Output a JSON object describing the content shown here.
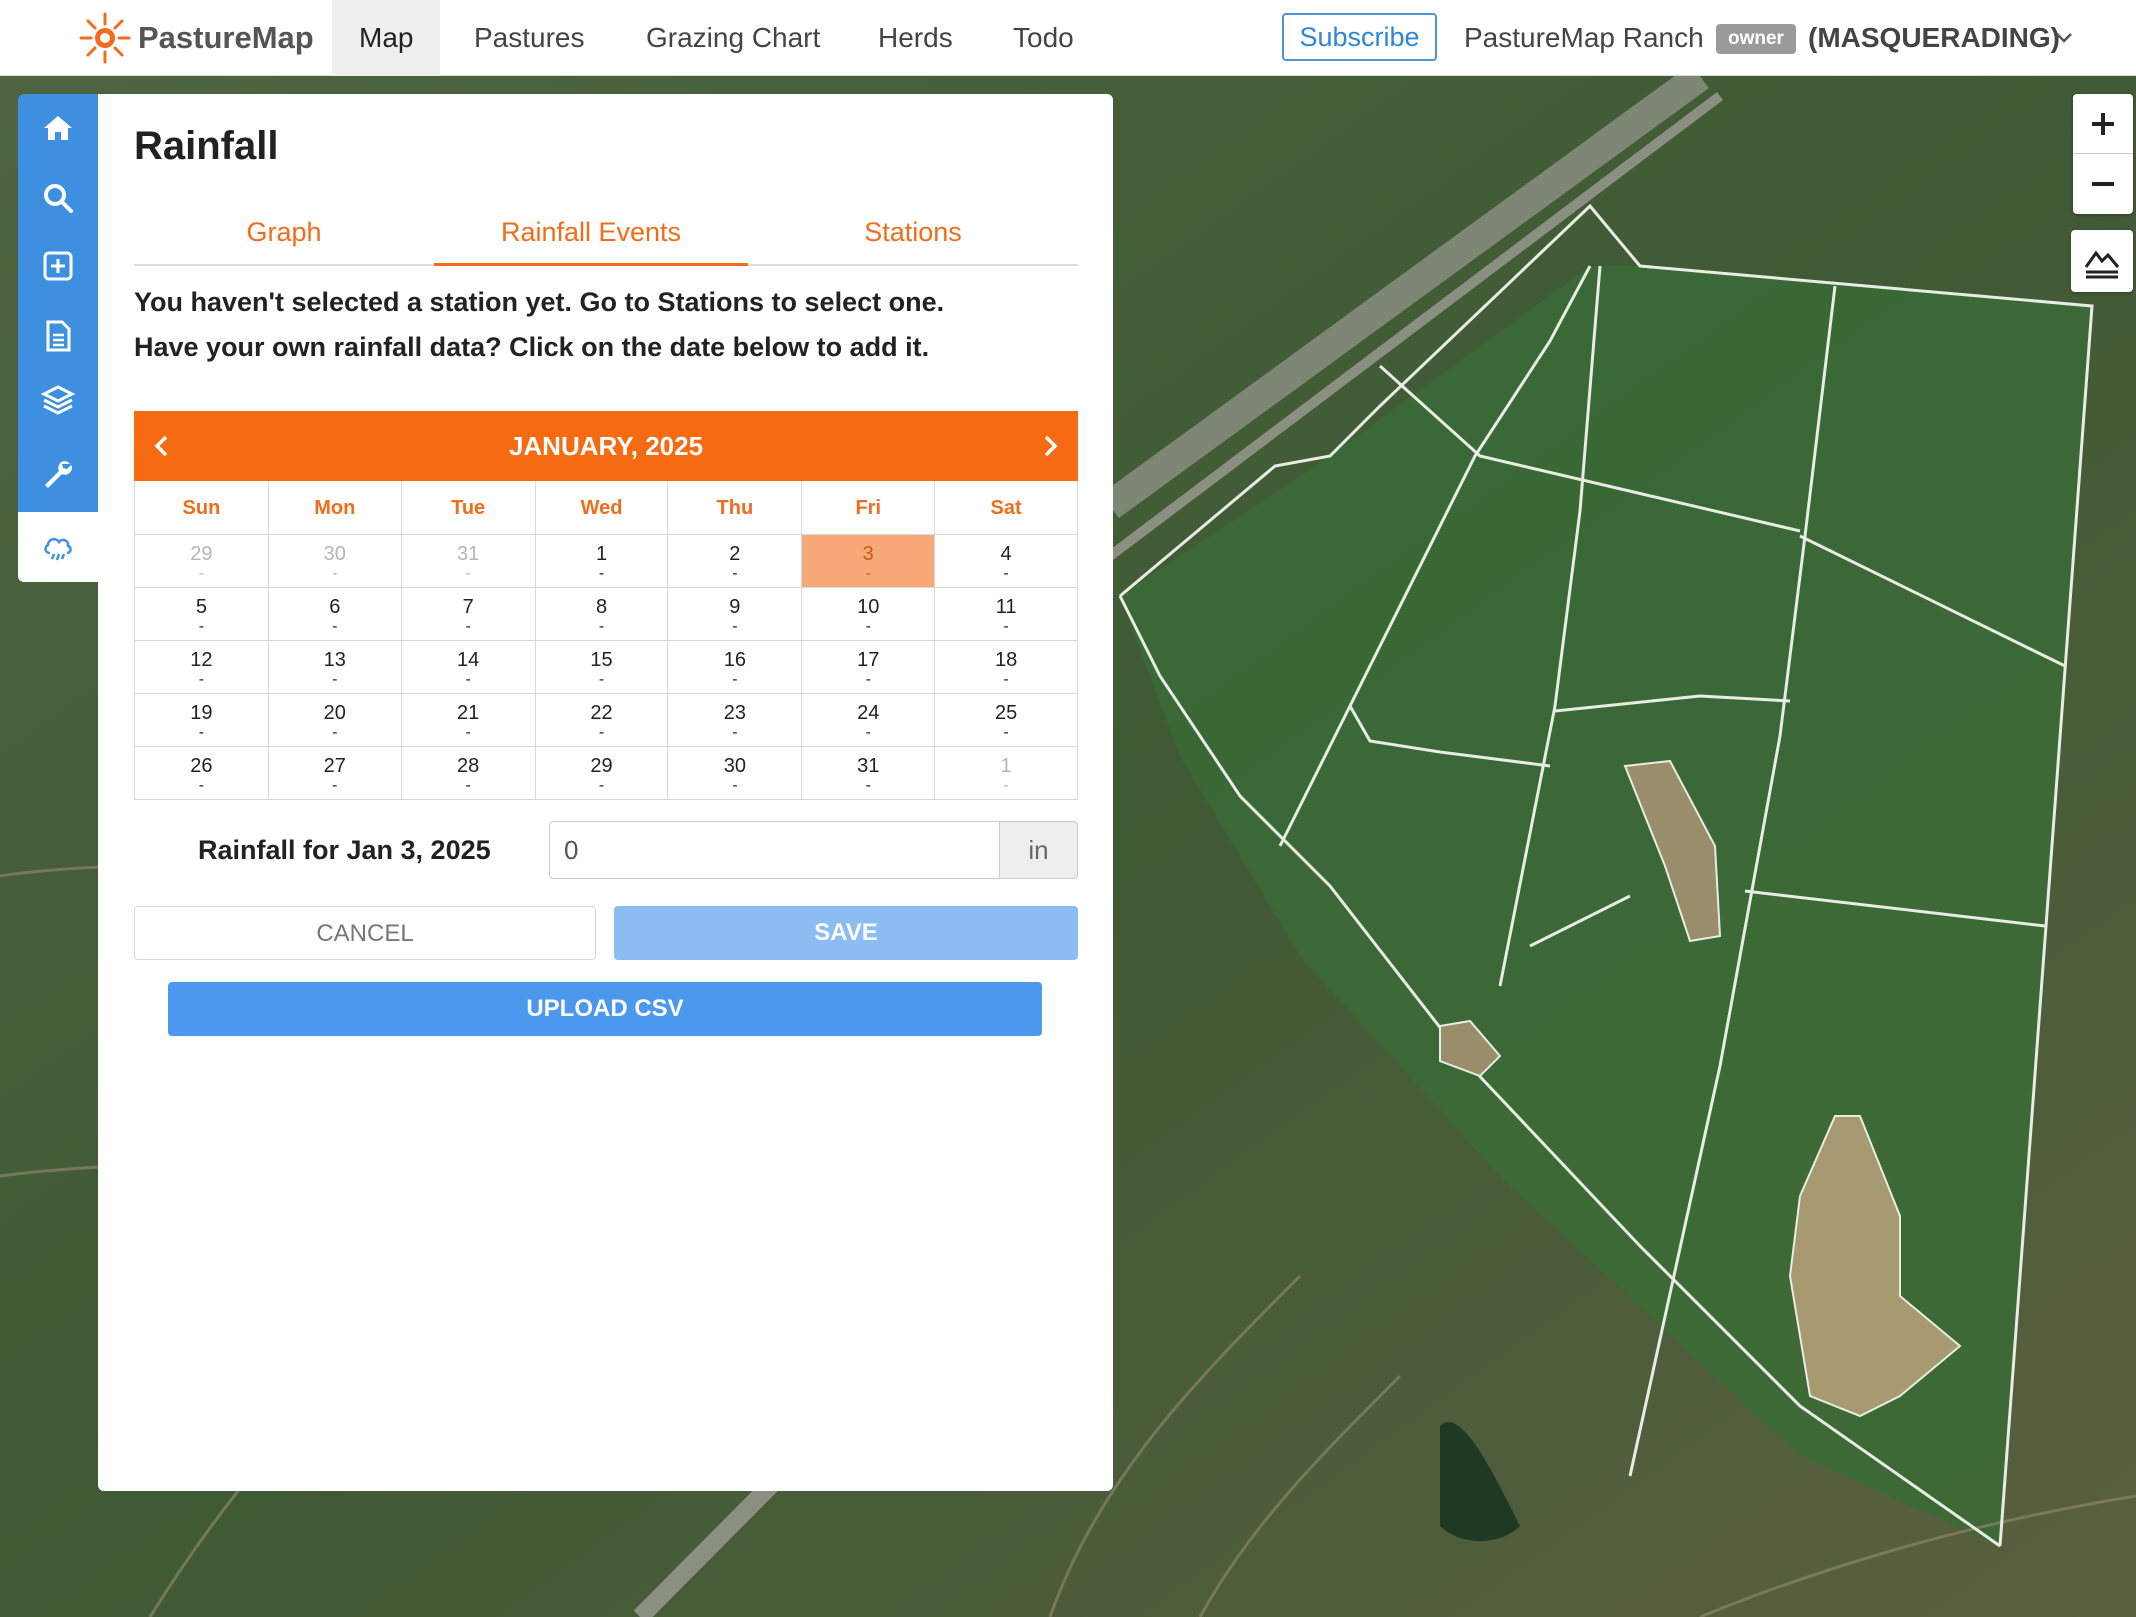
{
  "brand": {
    "name": "PastureMap"
  },
  "nav": {
    "items": [
      {
        "label": "Map",
        "active": true
      },
      {
        "label": "Pastures",
        "active": false
      },
      {
        "label": "Grazing Chart",
        "active": false
      },
      {
        "label": "Herds",
        "active": false
      },
      {
        "label": "Todo",
        "active": false
      }
    ],
    "subscribe_label": "Subscribe",
    "ranch_name": "PastureMap Ranch",
    "role_badge": "owner",
    "masquerade_label": "(MASQUERADING)"
  },
  "toolbar": {
    "icons": [
      "home-icon",
      "search-icon",
      "add-icon",
      "document-icon",
      "layers-icon",
      "wrench-icon",
      "rain-cloud-icon"
    ],
    "active": "rain-cloud-icon"
  },
  "panel": {
    "title": "Rainfall",
    "tabs": [
      {
        "label": "Graph",
        "active": false
      },
      {
        "label": "Rainfall Events",
        "active": true
      },
      {
        "label": "Stations",
        "active": false
      }
    ],
    "message_line1": "You haven't selected a station yet. Go to Stations to select one.",
    "message_line2": "Have your own rainfall data? Click on the date below to add it."
  },
  "calendar": {
    "month_label": "JANUARY, 2025",
    "weekdays": [
      "Sun",
      "Mon",
      "Tue",
      "Wed",
      "Thu",
      "Fri",
      "Sat"
    ],
    "weeks": [
      [
        {
          "d": "29",
          "v": "-",
          "out": true
        },
        {
          "d": "30",
          "v": "-",
          "out": true
        },
        {
          "d": "31",
          "v": "-",
          "out": true
        },
        {
          "d": "1",
          "v": "-"
        },
        {
          "d": "2",
          "v": "-"
        },
        {
          "d": "3",
          "v": "-",
          "sel": true
        },
        {
          "d": "4",
          "v": "-"
        }
      ],
      [
        {
          "d": "5",
          "v": "-"
        },
        {
          "d": "6",
          "v": "-"
        },
        {
          "d": "7",
          "v": "-"
        },
        {
          "d": "8",
          "v": "-"
        },
        {
          "d": "9",
          "v": "-"
        },
        {
          "d": "10",
          "v": "-"
        },
        {
          "d": "11",
          "v": "-"
        }
      ],
      [
        {
          "d": "12",
          "v": "-"
        },
        {
          "d": "13",
          "v": "-"
        },
        {
          "d": "14",
          "v": "-"
        },
        {
          "d": "15",
          "v": "-"
        },
        {
          "d": "16",
          "v": "-"
        },
        {
          "d": "17",
          "v": "-"
        },
        {
          "d": "18",
          "v": "-"
        }
      ],
      [
        {
          "d": "19",
          "v": "-"
        },
        {
          "d": "20",
          "v": "-"
        },
        {
          "d": "21",
          "v": "-"
        },
        {
          "d": "22",
          "v": "-"
        },
        {
          "d": "23",
          "v": "-"
        },
        {
          "d": "24",
          "v": "-"
        },
        {
          "d": "25",
          "v": "-"
        }
      ],
      [
        {
          "d": "26",
          "v": "-"
        },
        {
          "d": "27",
          "v": "-"
        },
        {
          "d": "28",
          "v": "-"
        },
        {
          "d": "29",
          "v": "-"
        },
        {
          "d": "30",
          "v": "-"
        },
        {
          "d": "31",
          "v": "-"
        },
        {
          "d": "1",
          "v": "-",
          "out": true
        }
      ]
    ]
  },
  "rainfall_form": {
    "label": "Rainfall for Jan 3, 2025",
    "value": "0",
    "unit": "in",
    "cancel_label": "CANCEL",
    "save_label": "SAVE",
    "upload_label": "UPLOAD CSV"
  },
  "map": {
    "zoom_in_label": "+",
    "zoom_out_label": "−"
  },
  "colors": {
    "accent_orange": "#f66b11",
    "primary_blue": "#3f8fe0",
    "selected_day": "#f7a877"
  }
}
